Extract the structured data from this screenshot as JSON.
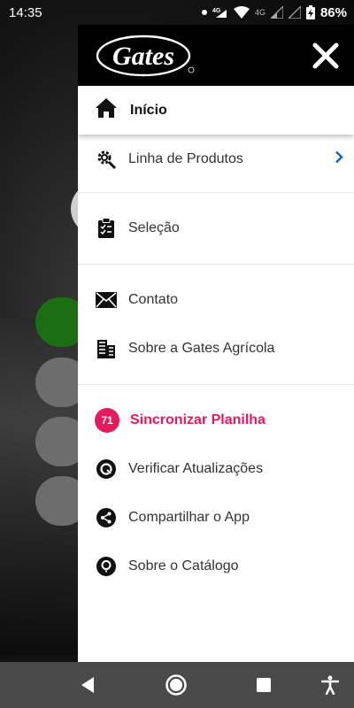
{
  "status_bar": {
    "time": "14:35",
    "network_type": "4G",
    "battery": "86%"
  },
  "drawer": {
    "brand": "Gates",
    "home": {
      "label": "Início",
      "icon": "home-icon"
    },
    "sections": [
      {
        "items": [
          {
            "label": "Linha de Produtos",
            "icon": "gear-search-icon",
            "has_chevron": true
          }
        ]
      },
      {
        "items": [
          {
            "label": "Seleção",
            "icon": "clipboard-icon"
          }
        ]
      },
      {
        "items": [
          {
            "label": "Contato",
            "icon": "mail-icon"
          },
          {
            "label": "Sobre a Gates Agrícola",
            "icon": "building-icon"
          }
        ]
      },
      {
        "items": [
          {
            "label": "Sincronizar Planilha",
            "icon": "badge",
            "badge": "71"
          },
          {
            "label": "Verificar Atualizações",
            "icon": "update-icon"
          },
          {
            "label": "Compartilhar o App",
            "icon": "share-icon"
          },
          {
            "label": "Sobre o Catálogo",
            "icon": "info-bulb-icon"
          }
        ]
      }
    ]
  },
  "colors": {
    "accent": "#e6195a",
    "chevron": "#1565c0",
    "header_bg": "#000000"
  }
}
